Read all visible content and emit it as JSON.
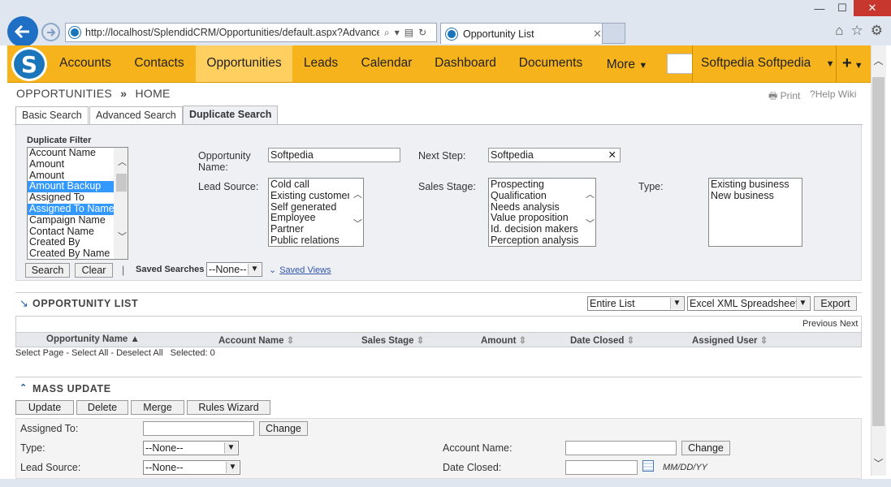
{
  "browser": {
    "url": "http://localhost/SplendidCRM/Opportunities/default.aspx?Advanced",
    "tab_title": "Opportunity List",
    "window_controls": {
      "minimize": "—",
      "maximize": "☐",
      "close": "✕"
    },
    "icons": [
      "back-icon",
      "forward-icon",
      "search-icon",
      "refresh-icon",
      "home-icon",
      "star-icon",
      "gear-icon"
    ]
  },
  "nav": {
    "items": [
      "Accounts",
      "Contacts",
      "Opportunities",
      "Leads",
      "Calendar",
      "Dashboard",
      "Documents",
      "More"
    ],
    "active": "Opportunities",
    "user": "Softpedia Softpedia",
    "accent_color": "#f7b31b"
  },
  "breadcrumb": {
    "module": "OPPORTUNITIES",
    "sep": "»",
    "page": "HOME"
  },
  "links": {
    "print": "Print",
    "help": "Help Wiki"
  },
  "search_tabs": [
    "Basic Search",
    "Advanced Search",
    "Duplicate Search"
  ],
  "duplicate_filter": {
    "title": "Duplicate Filter",
    "options": [
      "Account Name",
      "Amount",
      "Amount",
      "Amount Backup",
      "Assigned To",
      "Assigned To Name",
      "Campaign Name",
      "Contact Name",
      "Created By",
      "Created By Name"
    ],
    "selected": [
      "Amount Backup",
      "Assigned To Name"
    ]
  },
  "fields": {
    "opportunity_name_label": "Opportunity Name:",
    "opportunity_name_value": "Softpedia",
    "next_step_label": "Next Step:",
    "next_step_value": "Softpedia",
    "lead_source_label": "Lead Source:",
    "lead_source_options": [
      "Cold call",
      "Existing customer",
      "Self generated",
      "Employee",
      "Partner",
      "Public relations"
    ],
    "sales_stage_label": "Sales Stage:",
    "sales_stage_options": [
      "Prospecting",
      "Qualification",
      "Needs analysis",
      "Value proposition",
      "Id. decision makers",
      "Perception analysis"
    ],
    "type_label": "Type:",
    "type_options": [
      "Existing business",
      "New business"
    ]
  },
  "search_buttons": {
    "search": "Search",
    "clear": "Clear",
    "separator": "|"
  },
  "saved_searches": {
    "label": "Saved Searches",
    "value": "--None--",
    "saved_views": "Saved Views"
  },
  "list": {
    "title": "OPPORTUNITY LIST",
    "scope": "Entire List",
    "format": "Excel XML Spreadsheet",
    "export": "Export",
    "pager": "Previous Next",
    "columns": [
      "Opportunity Name",
      "Account Name",
      "Sales Stage",
      "Amount",
      "Date Closed",
      "Assigned User"
    ],
    "select_text": "Select Page - Select All - Deselect All",
    "selected_text": "Selected: 0"
  },
  "mass_update": {
    "title": "MASS UPDATE",
    "buttons": [
      "Update",
      "Delete",
      "Merge",
      "Rules Wizard"
    ],
    "assigned_to_label": "Assigned To:",
    "change": "Change",
    "type_label": "Type:",
    "type_value": "--None--",
    "lead_source_label": "Lead Source:",
    "lead_source_value": "--None--",
    "account_name_label": "Account Name:",
    "date_closed_label": "Date Closed:",
    "date_format": "MM/DD/YY"
  }
}
